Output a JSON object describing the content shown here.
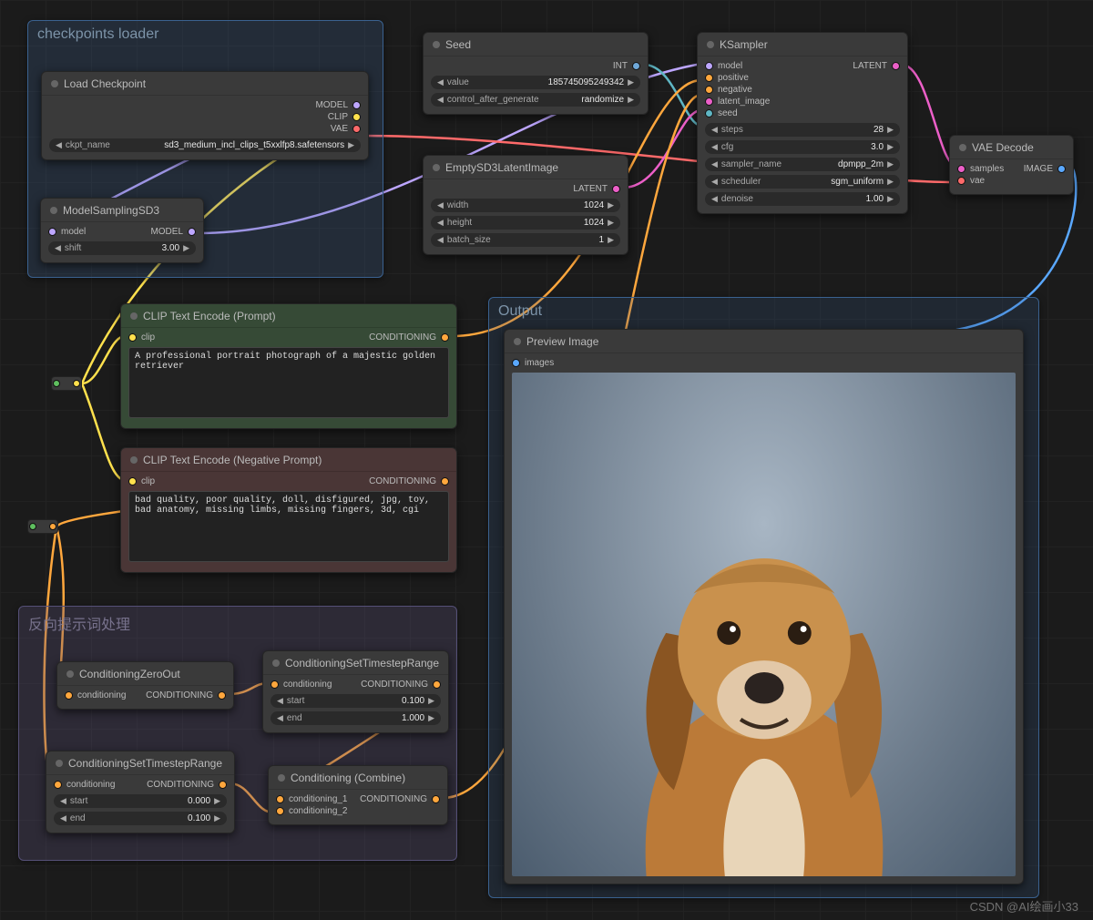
{
  "groups": {
    "ckpt": {
      "title": "checkpoints loader"
    },
    "output": {
      "title": "Output"
    },
    "neg": {
      "title": "反向提示词处理"
    }
  },
  "load_checkpoint": {
    "title": "Load Checkpoint",
    "outputs": [
      "MODEL",
      "CLIP",
      "VAE"
    ],
    "ckpt_label": "ckpt_name",
    "ckpt_value": "sd3_medium_incl_clips_t5xxlfp8.safetensors"
  },
  "sampling": {
    "title": "ModelSamplingSD3",
    "input": "model",
    "output": "MODEL",
    "shift_label": "shift",
    "shift_value": "3.00"
  },
  "seed": {
    "title": "Seed",
    "output": "INT",
    "value_label": "value",
    "value": "185745095249342",
    "ctrl_label": "control_after_generate",
    "ctrl_value": "randomize"
  },
  "latent": {
    "title": "EmptySD3LatentImage",
    "output": "LATENT",
    "width_label": "width",
    "width": "1024",
    "height_label": "height",
    "height": "1024",
    "batch_label": "batch_size",
    "batch": "1"
  },
  "ksampler": {
    "title": "KSampler",
    "inputs": [
      "model",
      "positive",
      "negative",
      "latent_image",
      "seed"
    ],
    "output": "LATENT",
    "steps_label": "steps",
    "steps": "28",
    "cfg_label": "cfg",
    "cfg": "3.0",
    "sampler_label": "sampler_name",
    "sampler": "dpmpp_2m",
    "sched_label": "scheduler",
    "sched": "sgm_uniform",
    "denoise_label": "denoise",
    "denoise": "1.00"
  },
  "vae": {
    "title": "VAE Decode",
    "inputs": [
      "samples",
      "vae"
    ],
    "output": "IMAGE"
  },
  "prompt": {
    "title": "CLIP Text Encode (Prompt)",
    "input": "clip",
    "output": "CONDITIONING",
    "text": "A professional portrait photograph of a majestic golden retriever"
  },
  "neg_prompt": {
    "title": "CLIP Text Encode (Negative Prompt)",
    "input": "clip",
    "output": "CONDITIONING",
    "text": "bad quality, poor quality, doll, disfigured, jpg, toy, bad anatomy, missing limbs, missing fingers, 3d, cgi"
  },
  "czo": {
    "title": "ConditioningZeroOut",
    "input": "conditioning",
    "output": "CONDITIONING"
  },
  "cstr1": {
    "title": "ConditioningSetTimestepRange",
    "input": "conditioning",
    "output": "CONDITIONING",
    "start_label": "start",
    "start": "0.100",
    "end_label": "end",
    "end": "1.000"
  },
  "cstr2": {
    "title": "ConditioningSetTimestepRange",
    "input": "conditioning",
    "output": "CONDITIONING",
    "start_label": "start",
    "start": "0.000",
    "end_label": "end",
    "end": "0.100"
  },
  "combine": {
    "title": "Conditioning (Combine)",
    "inputs": [
      "conditioning_1",
      "conditioning_2"
    ],
    "output": "CONDITIONING"
  },
  "preview": {
    "title": "Preview Image",
    "input": "images"
  },
  "colors": {
    "model": "#bda6ff",
    "clip": "#ffe14d",
    "vae": "#ff6a6a",
    "conditioning": "#ffa73d",
    "latent": "#ec5fc8",
    "image": "#5aa8ff",
    "int": "#6fa8d8",
    "seed": "#5fb6c4"
  },
  "watermark": "CSDN @AI绘画小33"
}
